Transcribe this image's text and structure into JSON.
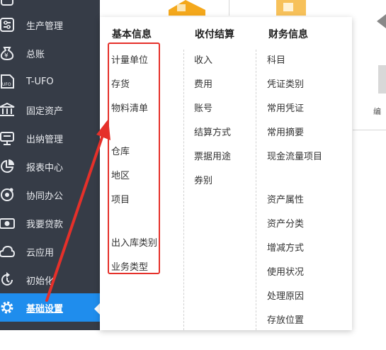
{
  "sidebar": {
    "items": [
      {
        "label": "",
        "icon": "partial-icon"
      },
      {
        "label": "生产管理",
        "icon": "sliders-icon"
      },
      {
        "label": "总账",
        "icon": "money-bag-icon"
      },
      {
        "label": "T-UFO",
        "icon": "ufo-doc-icon"
      },
      {
        "label": "固定资产",
        "icon": "bank-icon"
      },
      {
        "label": "出纳管理",
        "icon": "cashier-icon"
      },
      {
        "label": "报表中心",
        "icon": "pie-chart-icon"
      },
      {
        "label": "协同办公",
        "icon": "collab-icon"
      },
      {
        "label": "我要贷款",
        "icon": "loan-icon"
      },
      {
        "label": "云应用",
        "icon": "cloud-icon"
      },
      {
        "label": "初始化",
        "icon": "refresh-icon"
      },
      {
        "label": "基础设置",
        "icon": "gear-icon",
        "active": true
      }
    ]
  },
  "background": {
    "side_label": "编"
  },
  "menu": {
    "columns": [
      {
        "title": "基本信息",
        "items": [
          "计量单位",
          "存货",
          "物料清单",
          "仓库",
          "地区",
          "项目",
          "出入库类别",
          "业务类型"
        ]
      },
      {
        "title": "收付结算",
        "items": [
          "收入",
          "费用",
          "账号",
          "结算方式",
          "票据用途",
          "券别"
        ]
      },
      {
        "title": "财务信息",
        "items": [
          "科目",
          "凭证类别",
          "常用凭证",
          "常用摘要",
          "现金流量项目",
          "资产属性",
          "资产分类",
          "增减方式",
          "使用状况",
          "处理原因",
          "存放位置"
        ]
      }
    ]
  },
  "colors": {
    "sidebar_bg": "#363c47",
    "active_bg": "#1f8ded",
    "highlight": "#e5302a"
  }
}
